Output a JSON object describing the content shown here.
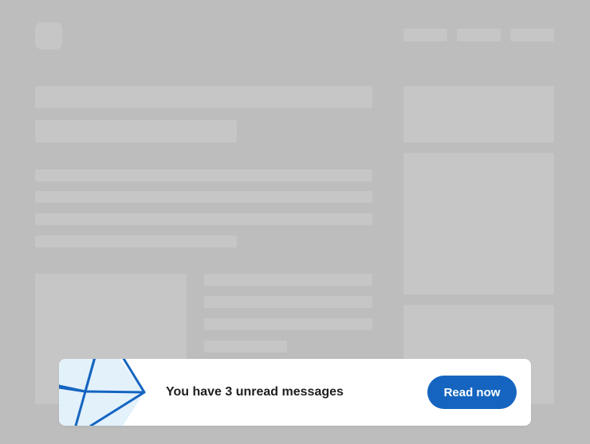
{
  "notification": {
    "message": "You have 3 unread messages",
    "action_label": "Read now",
    "icon": "envelope-icon"
  },
  "colors": {
    "backdrop": "#bdbdbd",
    "skeleton": "#c6c6c6",
    "toast_background": "#ffffff",
    "accent": "#1565c0",
    "envelope_fill": "#e3f1fb",
    "text": "#1f1f1f"
  }
}
